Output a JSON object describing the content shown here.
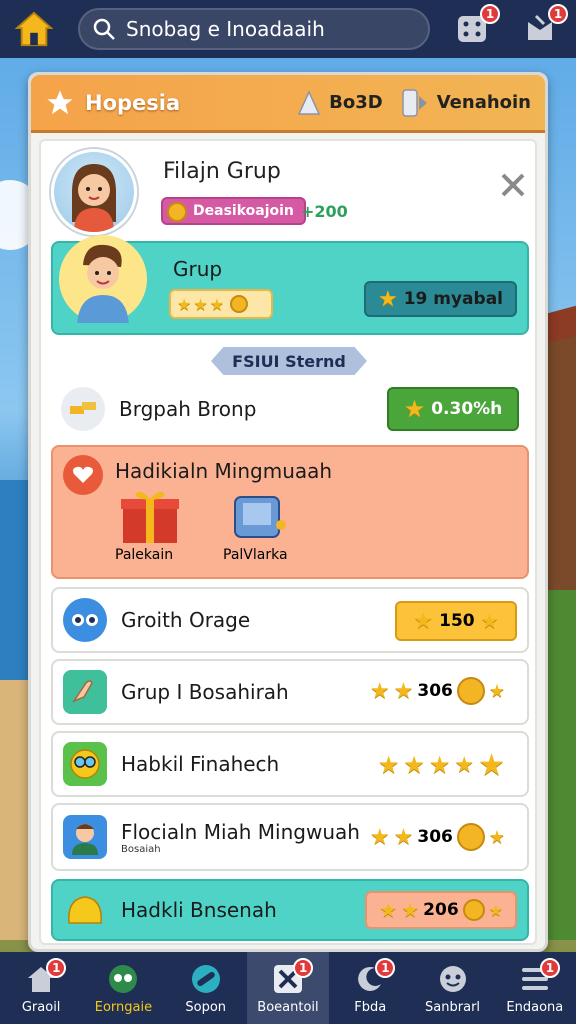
{
  "search": {
    "placeholder": "Snobag e Inoadaaih"
  },
  "topbar": {
    "badge_1": "1",
    "badge_2": "1"
  },
  "panel": {
    "title": "Hopesia",
    "right_1": "Bo3D",
    "right_2": "Venahoin"
  },
  "profile": {
    "name": "Filajn Grup",
    "pill": "Deasikoajoin",
    "delta": "+200"
  },
  "group_card": {
    "name": "Grup",
    "reward": "19 myabal"
  },
  "divider": "FSIUI Sternd",
  "rows": [
    {
      "label": "Brgpah Bronp",
      "reward": "0.30%h"
    },
    {
      "label": "Hadikialn Mingmuaah",
      "sub_1": "Palekain",
      "sub_2": "PalVlarka"
    },
    {
      "label": "Groith Orage",
      "reward": "150"
    },
    {
      "label": "Grup I Bosahirah",
      "reward": "306"
    },
    {
      "label": "Habkil Finahech"
    },
    {
      "label": "Flocialn Miah Mingwuah",
      "sub": "Bosaiah",
      "reward": "306"
    },
    {
      "label": "Hadkli Bnsenah",
      "reward": "206"
    }
  ],
  "nav": [
    {
      "label": "Graoil",
      "badge": "1"
    },
    {
      "label": "Eorngaie"
    },
    {
      "label": "Sopon"
    },
    {
      "label": "Boeantoil",
      "badge": "1"
    },
    {
      "label": "Fbda",
      "badge": "1"
    },
    {
      "label": "Sanbrarl"
    },
    {
      "label": "Endaona",
      "badge": "1"
    }
  ],
  "colors": {
    "header": "#f5a34a",
    "teal": "#4fd3c6",
    "salmon": "#fbb293",
    "nav": "#1f2e55",
    "gold": "#f5b81c"
  }
}
